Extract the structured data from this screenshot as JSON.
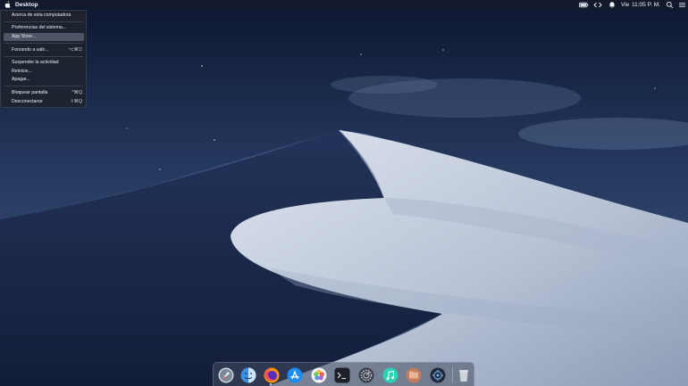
{
  "menubar": {
    "app_name": "Desktop",
    "day": "Vie",
    "time": "11:05 P. M.",
    "status_icons": [
      "battery-icon",
      "code-arrows-icon",
      "notification-icon",
      "search-icon",
      "list-icon"
    ]
  },
  "apple_menu": {
    "items": [
      {
        "label": "Acerca de esta computadora",
        "shortcut": ""
      },
      {
        "label": "Preferencias del sistema...",
        "shortcut": ""
      },
      {
        "label": "App Store...",
        "shortcut": ""
      },
      {
        "label": "Forzando a salir...",
        "shortcut": "⌥⌘⎋"
      },
      {
        "label": "Suspender la actividad",
        "shortcut": ""
      },
      {
        "label": "Reinicie...",
        "shortcut": ""
      },
      {
        "label": "Apagar...",
        "shortcut": ""
      },
      {
        "label": "Bloquear pantalla",
        "shortcut": "^⌘Q"
      },
      {
        "label": "Desconectarse",
        "shortcut": "⇧⌘Q"
      }
    ],
    "highlighted": "App Store..."
  },
  "dock": {
    "apps": [
      "launchpad-icon",
      "finder-icon",
      "firefox-icon",
      "app-store-icon",
      "photos-icon",
      "terminal-icon",
      "system-preferences-icon",
      "music-icon",
      "files-icon",
      "screenshot-icon",
      "trash-icon"
    ]
  },
  "colors": {
    "sky_top": "#0f1a33",
    "sky_bottom": "#3a5277",
    "dune_light": "#c7d0e0",
    "dune_shadow": "#1f2c4e"
  }
}
